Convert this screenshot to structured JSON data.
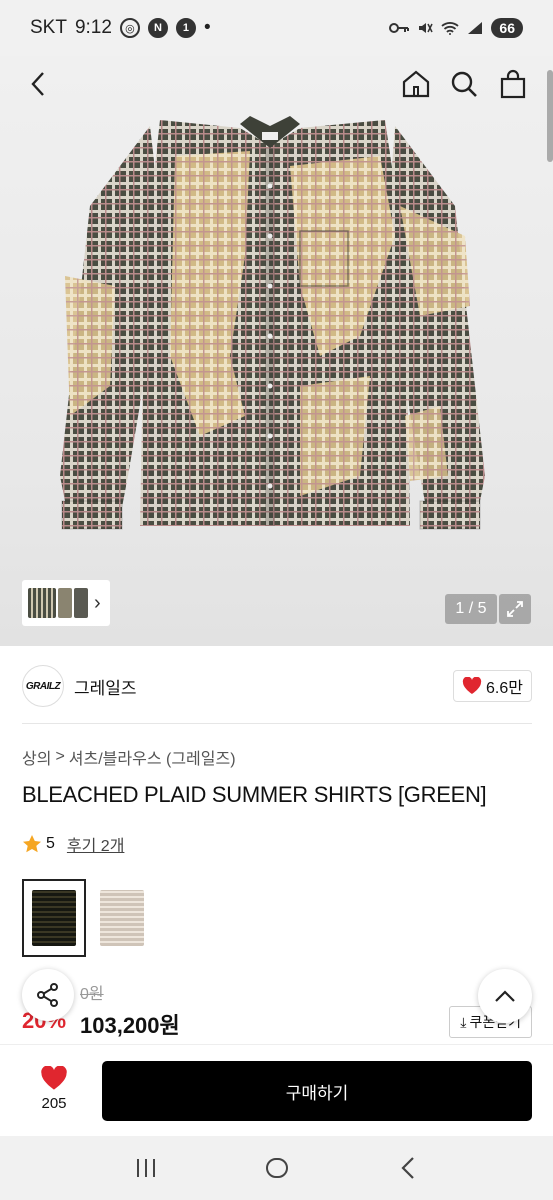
{
  "status_bar": {
    "carrier": "SKT",
    "time": "9:12",
    "badge_1": "N",
    "badge_2": "1",
    "dot": "•",
    "battery": "66"
  },
  "nav": {
    "back_icon": "chevron-left-icon",
    "home_icon": "home-icon",
    "search_icon": "search-icon",
    "cart_icon": "shopping-bag-icon"
  },
  "gallery": {
    "page_indicator": "1 / 5",
    "thumbs_chevron": "›"
  },
  "brand": {
    "logo_text": "GRAILZ",
    "name": "그레일즈",
    "likes": "6.6만"
  },
  "breadcrumb": {
    "category": "상의",
    "separator": ">",
    "subcategory": "셔츠/블라우스 (그레일즈)"
  },
  "product": {
    "title": "BLEACHED PLAID SUMMER SHIRTS [GREEN]",
    "rating": "5",
    "reviews": "후기 2개"
  },
  "price": {
    "original": "0원",
    "discount": "20%",
    "sale": "103,200원",
    "coupon_label": "쿠폰받기"
  },
  "bottom_bar": {
    "like_count": "205",
    "buy_label": "구매하기"
  },
  "colors": {
    "accent_red": "#e0262f",
    "button_black": "#000000"
  }
}
